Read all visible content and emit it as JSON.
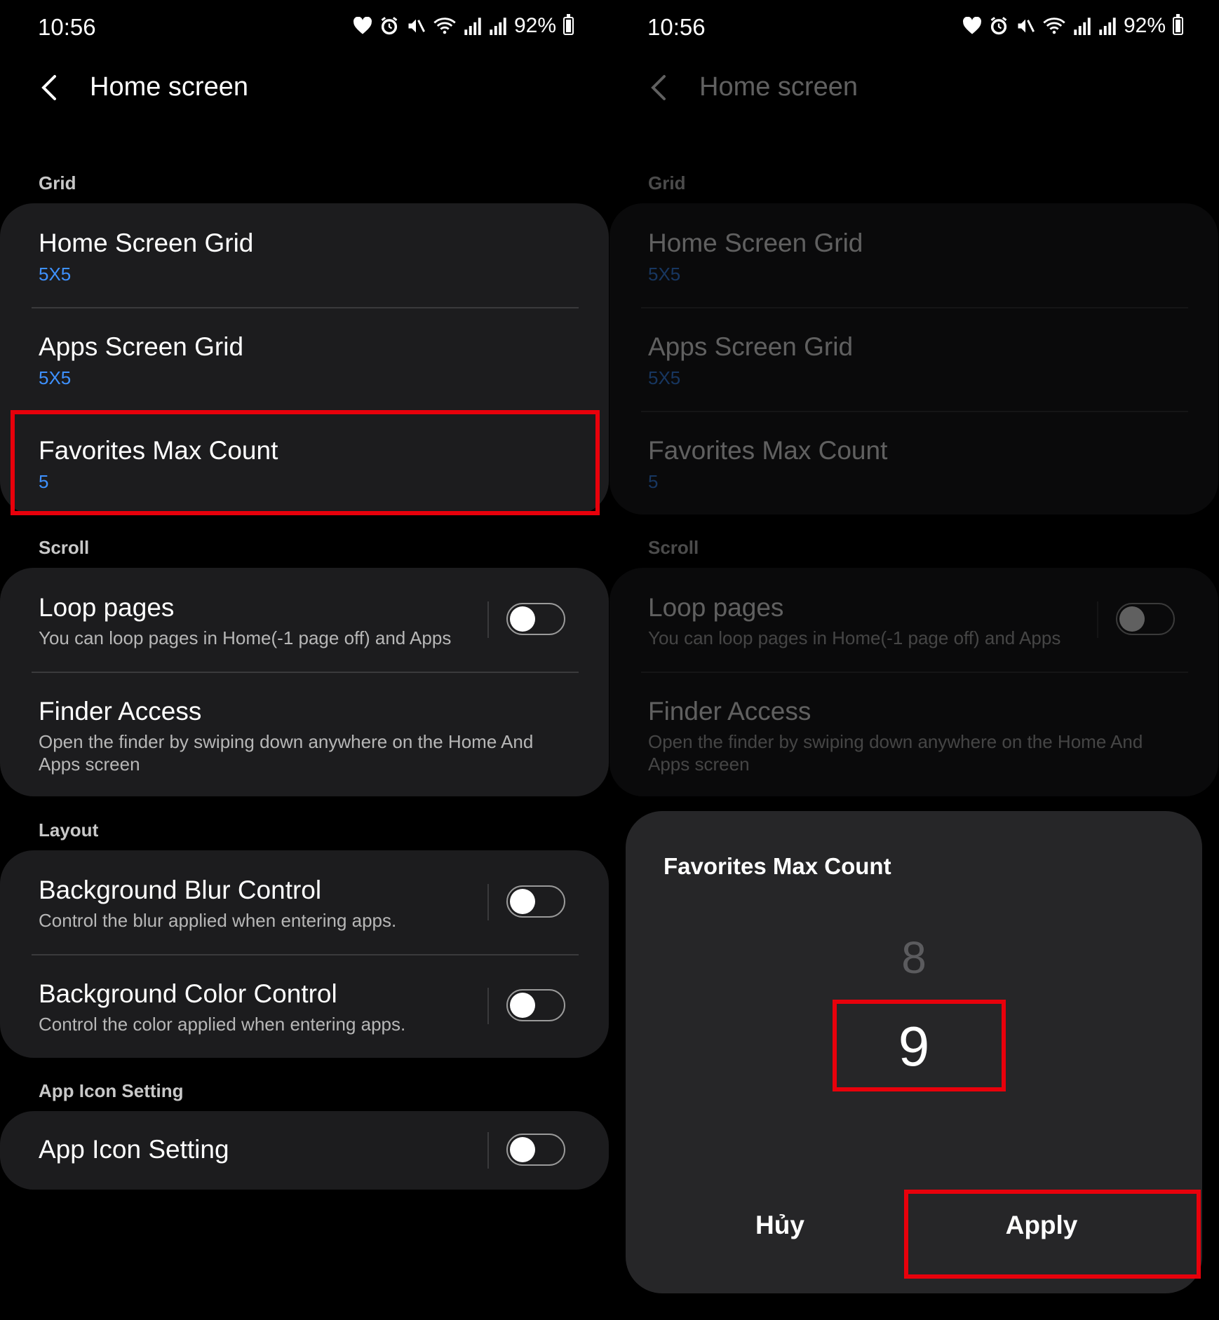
{
  "status": {
    "time": "10:56",
    "battery": "92%",
    "icons": [
      "heart-icon",
      "alarm-icon",
      "mute-icon",
      "wifi-icon",
      "signal-icon",
      "signal-icon",
      "battery-icon"
    ]
  },
  "header": {
    "title": "Home screen"
  },
  "sections": {
    "grid": "Grid",
    "scroll": "Scroll",
    "layout": "Layout",
    "app_icon": "App Icon Setting"
  },
  "items": {
    "home_grid": {
      "title": "Home Screen Grid",
      "value": "5X5"
    },
    "apps_grid": {
      "title": "Apps Screen Grid",
      "value": "5X5"
    },
    "fav_max": {
      "title": "Favorites Max Count",
      "value": "5"
    },
    "loop_pages": {
      "title": "Loop pages",
      "desc": "You can loop pages in Home(-1 page off) and Apps",
      "enabled": false
    },
    "finder_access": {
      "title": "Finder Access",
      "desc": "Open the finder by swiping down anywhere on the Home And Apps screen"
    },
    "blur_control": {
      "title": "Background Blur Control",
      "desc": "Control the blur applied when entering apps.",
      "enabled": false
    },
    "color_control": {
      "title": "Background Color Control",
      "desc": "Control the color applied when entering apps.",
      "enabled": false
    },
    "app_icon_setting": {
      "title": "App Icon Setting",
      "enabled": false
    }
  },
  "dialog": {
    "title": "Favorites Max Count",
    "picker_prev": "8",
    "picker_selected": "9",
    "cancel_label": "Hủy",
    "apply_label": "Apply"
  },
  "colors": {
    "accent": "#3e91ff",
    "highlight": "#e8000b",
    "card": "#1c1c1e",
    "dialog": "#262628"
  }
}
